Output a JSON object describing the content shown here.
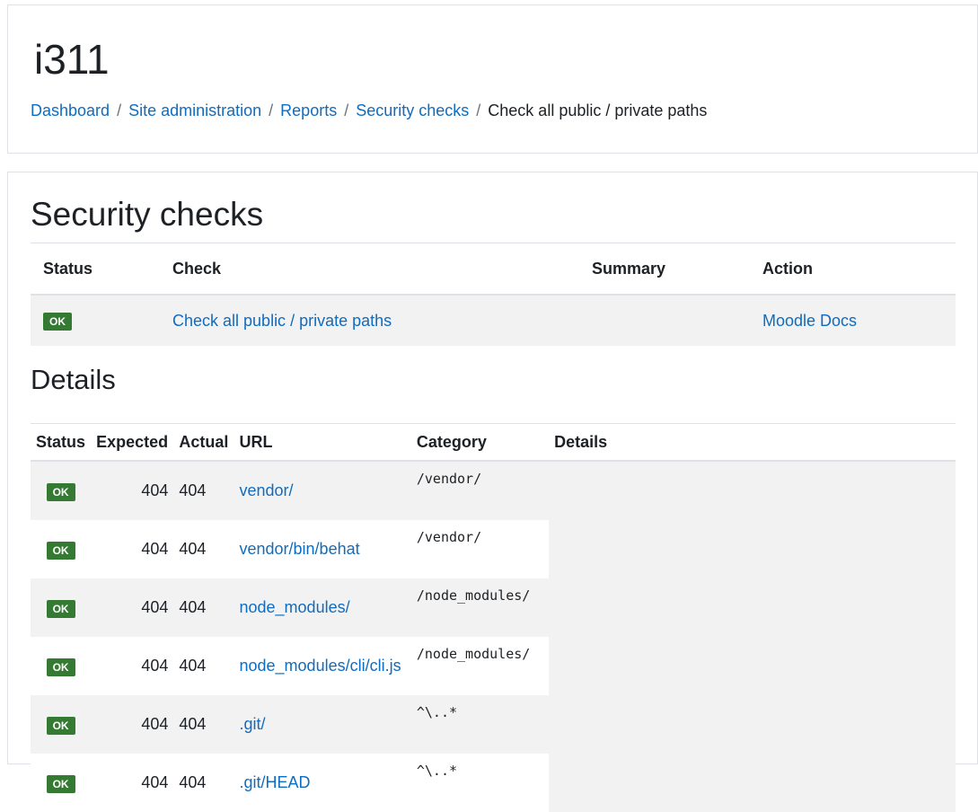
{
  "header": {
    "site_title": "i311",
    "breadcrumb": {
      "items": [
        "Dashboard",
        "Site administration",
        "Reports",
        "Security checks"
      ],
      "separator": "/",
      "current": "Check all public / private paths"
    }
  },
  "security_checks": {
    "heading": "Security checks",
    "columns": [
      "Status",
      "Check",
      "Summary",
      "Action"
    ],
    "row": {
      "status": "OK",
      "check": "Check all public / private paths",
      "summary": "",
      "action": "Moodle Docs"
    }
  },
  "details": {
    "heading": "Details",
    "columns": [
      "Status",
      "Expected",
      "Actual",
      "URL",
      "Category",
      "Details"
    ],
    "rows": [
      {
        "status": "OK",
        "expected": "404",
        "actual": "404",
        "url": "vendor/",
        "category": "/vendor/"
      },
      {
        "status": "OK",
        "expected": "404",
        "actual": "404",
        "url": "vendor/bin/behat",
        "category": "/vendor/"
      },
      {
        "status": "OK",
        "expected": "404",
        "actual": "404",
        "url": "node_modules/",
        "category": "/node_modules/"
      },
      {
        "status": "OK",
        "expected": "404",
        "actual": "404",
        "url": "node_modules/cli/cli.js",
        "category": "/node_modules/"
      },
      {
        "status": "OK",
        "expected": "404",
        "actual": "404",
        "url": ".git/",
        "category": "^\\..*"
      },
      {
        "status": "OK",
        "expected": "404",
        "actual": "404",
        "url": ".git/HEAD",
        "category": "^\\..*"
      }
    ]
  },
  "colors": {
    "link": "#0f6cbf",
    "ok_badge": "#357a32",
    "stripe": "#f2f2f2",
    "border": "#dee2e6"
  }
}
